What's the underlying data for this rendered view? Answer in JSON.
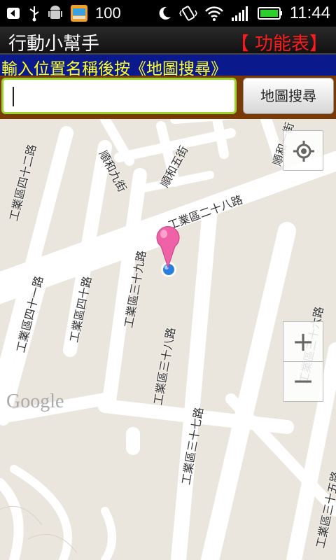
{
  "status_bar": {
    "battery_app_text": "100",
    "time": "11:44",
    "icons": [
      "back-icon",
      "usb-icon",
      "android-debug-icon",
      "bus-app-icon",
      "moon-icon",
      "vibrate-icon",
      "wifi-icon",
      "signal-icon",
      "battery-icon"
    ]
  },
  "app": {
    "title": "行動小幫手",
    "menu_label": "【 功能表】"
  },
  "hint": {
    "text": "輸入位置名稱後按《地圖搜尋》"
  },
  "search": {
    "value": "",
    "button_label": "地圖搜尋"
  },
  "map": {
    "road_labels": {
      "shunhe_9": "順和九街",
      "shunhe_5": "順和五街",
      "shunhe_1": "順和一街",
      "gyq_28": "工業區二十八路",
      "gyq_42": "工業區四十二路",
      "gyq_39": "工業區三十九路",
      "gyq_41": "工業區四十一路",
      "gyq_40": "工業區四十路",
      "gyq_38": "工業區三十八路",
      "gyq_37": "工業區三十七路",
      "gyq_36": "工業區三十六路",
      "gyq_35": "工業區三十五路"
    },
    "logo": "Google",
    "zoom_in_label": "+",
    "zoom_out_label": "−",
    "colors": {
      "background": "#ebe6dd",
      "road": "#ffffff",
      "pin": "#f062a8",
      "location_dot": "#2a7de1"
    }
  }
}
